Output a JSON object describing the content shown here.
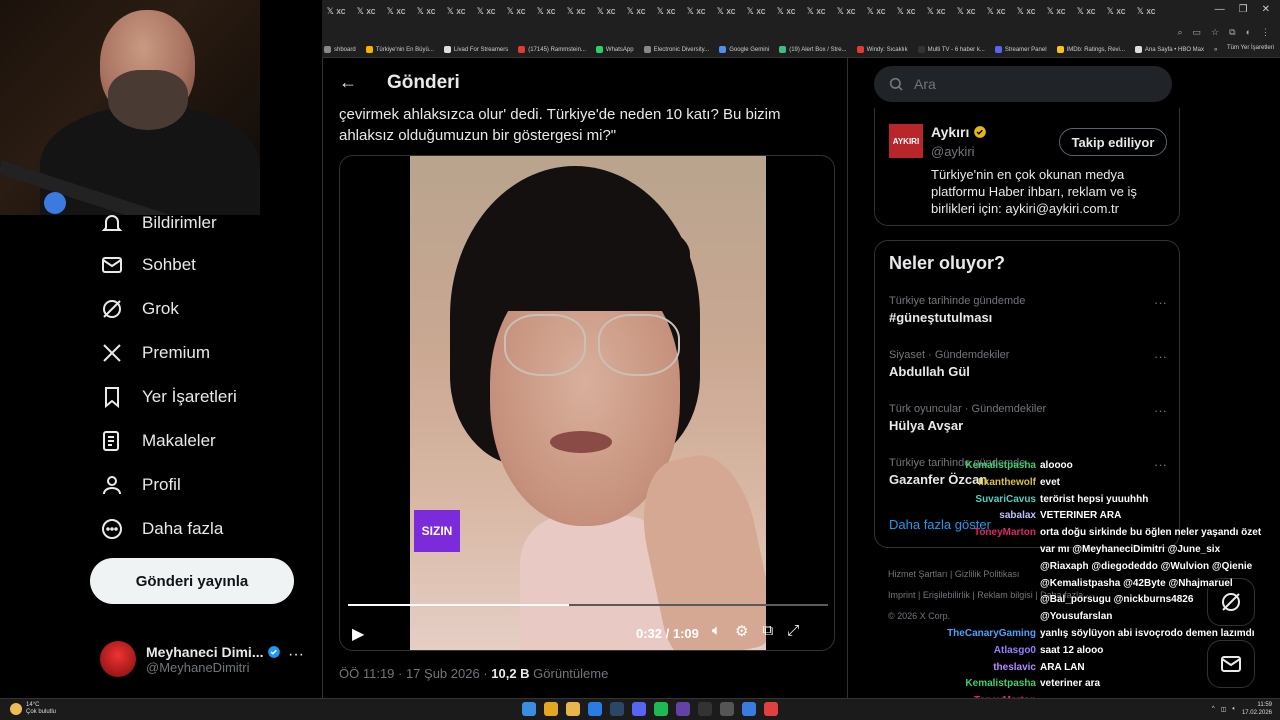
{
  "browser": {
    "tab_label": "𝕏 xc",
    "tab_count": 28,
    "bookmarks": [
      {
        "label": "shboard",
        "color": "#888"
      },
      {
        "label": "Türkiye'nin En Büyü...",
        "color": "#f5b400"
      },
      {
        "label": "Livad For Streamers",
        "color": "#ddd"
      },
      {
        "label": "(17145) Rammstein...",
        "color": "#e53935"
      },
      {
        "label": "WhatsApp",
        "color": "#25d366"
      },
      {
        "label": "Electronic Diversity...",
        "color": "#888"
      },
      {
        "label": "Google Gemini",
        "color": "#4f8df5"
      },
      {
        "label": "(19) Alert Box / Stre...",
        "color": "#3fbf7f"
      },
      {
        "label": "Windy: Sıcaklık",
        "color": "#e53935"
      },
      {
        "label": "Multi TV - 6 haber k...",
        "color": "#333"
      },
      {
        "label": "Streamer Panel",
        "color": "#5865f2"
      },
      {
        "label": "IMDb: Ratings, Revi...",
        "color": "#f5c518"
      },
      {
        "label": "Ana Sayfa • HBO Max",
        "color": "#ddd"
      }
    ],
    "bookmarks_more": "»",
    "all_bookmarks": "Tüm Yer İşaretleri"
  },
  "sidebar": {
    "items": [
      {
        "label": "Bildirimler"
      },
      {
        "label": "Sohbet"
      },
      {
        "label": "Grok"
      },
      {
        "label": "Premium"
      },
      {
        "label": "Yer İşaretleri"
      },
      {
        "label": "Makaleler"
      },
      {
        "label": "Profil"
      },
      {
        "label": "Daha fazla"
      }
    ],
    "post_button": "Gönderi yayınla",
    "profile": {
      "name": "Meyhaneci Dimi...",
      "handle": "@MeyhaneDimitri",
      "more": "···"
    }
  },
  "main": {
    "header_title": "Gönderi",
    "tweet_text": "çevirmek ahlaksızca olur' dedi. Türkiye'de neden 10 katı? Bu bizim ahlaksız olduğumuzun bir göstergesi mi?\"",
    "video": {
      "overlay_text": "SIZIN",
      "time": "0:32 / 1:09",
      "progress": 0.46
    },
    "meta": {
      "time": "ÖÖ 11:19 · 17 Şub 2026 · ",
      "views": "10,2 B",
      "views_label": " Görüntüleme"
    }
  },
  "right": {
    "search_placeholder": "Ara",
    "account": {
      "logo_text": "AYKIRI",
      "name": "Aykırı",
      "handle": "@aykiri",
      "follow_label": "Takip ediliyor",
      "bio": "Türkiye'nin en çok okunan medya platformu Haber ihbarı, reklam ve iş birlikleri için: aykiri@aykiri.com.tr"
    },
    "trends_title": "Neler oluyor?",
    "trends": [
      {
        "context": "Türkiye tarihinde gündemde",
        "name": "#güneştutulması"
      },
      {
        "context": "Siyaset · Gündemdekiler",
        "name": "Abdullah Gül"
      },
      {
        "context": "Türk oyuncular · Gündemdekiler",
        "name": "Hülya Avşar"
      },
      {
        "context": "Türkiye tarihinde gündemde",
        "name": "Gazanfer Özcan"
      }
    ],
    "trend_more": "···",
    "show_more": "Daha fazla göster",
    "footer": [
      "Hizmet Şartları",
      "Gizlilik Politikası",
      "Imprint",
      "Erişilebilirlik",
      "Reklam bilgisi",
      "Daha fazla ···",
      "© 2026 X Corp."
    ]
  },
  "chat": [
    {
      "user": "Kemalistpasha",
      "color": "#3cd070",
      "msg": "aloooo"
    },
    {
      "user": "Ilkanthewolf",
      "color": "#d9c23a",
      "msg": "evet"
    },
    {
      "user": "SuvariCavus",
      "color": "#4fd0c0",
      "msg": "terörist hepsi yuuuhhh"
    },
    {
      "user": "sabalax",
      "color": "#c0c0ff",
      "msg": "VETERINER ARA"
    },
    {
      "user": "ToneyMarton",
      "color": "#e0246b",
      "msg": "orta doğu sirkinde bu öğlen neler yaşandı özet"
    },
    {
      "user": "",
      "color": "#fff",
      "msg": "var mı @MeyhaneciDimitri @June_six"
    },
    {
      "user": "",
      "color": "#fff",
      "msg": "@Riaxaph @diegodeddo @Wulvion @Qienie"
    },
    {
      "user": "",
      "color": "#fff",
      "msg": "@Kemalistpasha @42Byte @Nhajmaruel"
    },
    {
      "user": "",
      "color": "#fff",
      "msg": "@Bal_porsugu @nickburns4826"
    },
    {
      "user": "",
      "color": "#fff",
      "msg": "@Yousufarslan"
    },
    {
      "user": "TheCanaryGaming",
      "color": "#4aa3ff",
      "msg": "yanlış söylüyon abi isvoçrodo demen lazımdı"
    },
    {
      "user": "Atlasgo0",
      "color": "#9b7cff",
      "msg": "saat 12 alooo"
    },
    {
      "user": "theslavic",
      "color": "#b28cff",
      "msg": "ARA LAN"
    },
    {
      "user": "Kemalistpasha",
      "color": "#3cd070",
      "msg": "veteriner ara"
    },
    {
      "user": "ToneyMarton",
      "color": "#e0246b",
      "msg": ""
    }
  ],
  "taskbar": {
    "weather_temp": "14°C",
    "weather_desc": "Çok bulutlu",
    "time": "11:59",
    "date": "17.02.2026"
  }
}
